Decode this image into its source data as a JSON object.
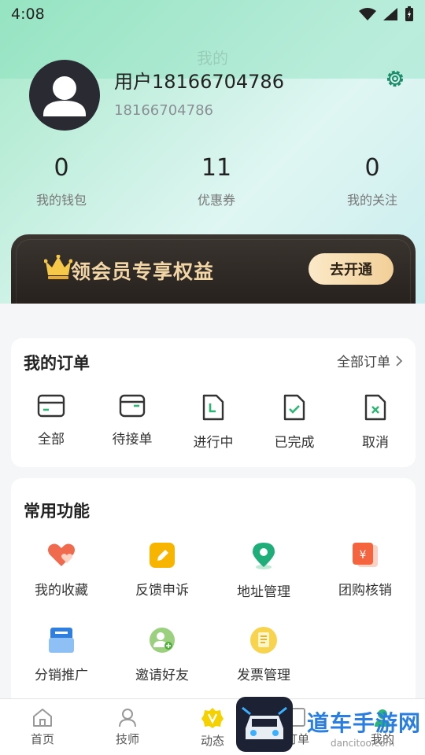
{
  "status_bar": {
    "time": "4:08"
  },
  "header": {
    "title": "我的"
  },
  "profile": {
    "username": "用户18166704786",
    "phone": "18166704786"
  },
  "stats": [
    {
      "value": "0",
      "label": "我的钱包"
    },
    {
      "value": "11",
      "label": "优惠券"
    },
    {
      "value": "0",
      "label": "我的关注"
    }
  ],
  "vip_banner": {
    "text": "领会员专享权益",
    "button": "去开通"
  },
  "orders": {
    "title": "我的订单",
    "all_link": "全部订单",
    "items": [
      {
        "label": "全部",
        "icon": "card-icon"
      },
      {
        "label": "待接单",
        "icon": "inbox-icon"
      },
      {
        "label": "进行中",
        "icon": "doc-progress-icon"
      },
      {
        "label": "已完成",
        "icon": "doc-check-icon"
      },
      {
        "label": "取消",
        "icon": "doc-cancel-icon"
      }
    ]
  },
  "functions": {
    "title": "常用功能",
    "items": [
      {
        "label": "我的收藏",
        "icon": "heart-icon"
      },
      {
        "label": "反馈申诉",
        "icon": "edit-icon"
      },
      {
        "label": "地址管理",
        "icon": "location-icon"
      },
      {
        "label": "团购核销",
        "icon": "yuan-voucher-icon"
      },
      {
        "label": "分销推广",
        "icon": "mail-icon"
      },
      {
        "label": "邀请好友",
        "icon": "add-friend-icon"
      },
      {
        "label": "发票管理",
        "icon": "invoice-icon"
      }
    ]
  },
  "tabbar": {
    "items": [
      {
        "label": "首页",
        "icon": "home-icon"
      },
      {
        "label": "技师",
        "icon": "technician-icon"
      },
      {
        "label": "动态",
        "icon": "v-badge-icon"
      },
      {
        "label": "订单",
        "icon": "order-icon"
      },
      {
        "label": "我的",
        "icon": "me-icon"
      }
    ]
  },
  "watermark": {
    "text": "道车手游网",
    "sub": "dancitoo.com"
  },
  "colors": {
    "accent_green": "#2bb673",
    "gold": "#f3d6a6",
    "vip_bg": "#241f1b"
  }
}
